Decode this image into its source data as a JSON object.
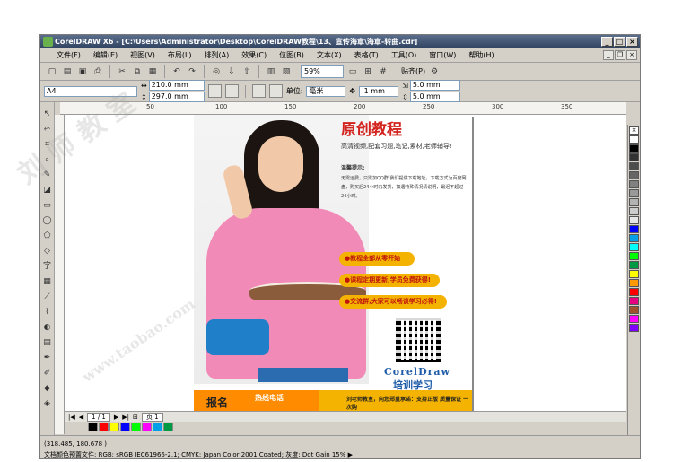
{
  "window": {
    "title": "CorelDRAW X6 - [C:\\Users\\Administrator\\Desktop\\CorelDRAW教程\\13、宣传海章\\海章-转曲.cdr]"
  },
  "menu": [
    "文件(F)",
    "编辑(E)",
    "视图(V)",
    "布局(L)",
    "排列(A)",
    "效果(C)",
    "位图(B)",
    "文本(X)",
    "表格(T)",
    "工具(O)",
    "窗口(W)",
    "帮助(H)"
  ],
  "standard_bar": {
    "zoom": "59%",
    "snap": "贴齐(P)"
  },
  "property_bar": {
    "paper": "A4",
    "width": "210.0 mm",
    "height": "297.0 mm",
    "units_label": "单位:",
    "units": "毫米",
    "nudge": ".1 mm",
    "dup_x": "5.0 mm",
    "dup_y": "5.0 mm"
  },
  "ruler": {
    "top": [
      "50",
      "100",
      "150",
      "200",
      "250",
      "300",
      "350"
    ]
  },
  "poster": {
    "title": "原创教程",
    "subtitle": "高清视频,配套习题,笔记,素材,老师辅导!",
    "tip_head": "温馨提示:",
    "tip": "无需运费，只需加QQ群,我们提供下载地址，下载方式为百度网盘，购买后24小时内发货，如遇特殊情况请说明，最迟不超过24小时。",
    "pills": [
      "●教程全部从零开始",
      "●课程定期更新,学员免费获得!",
      "●交流群,大家可以畅谈学习必得!"
    ],
    "brand1": "CorelDraw",
    "brand2": "培训学习",
    "bottom_left": "报名",
    "bottom_hotline": "热线电话",
    "bottom_right": "刘老师教室，向您郑重承诺：支持正版 质量保证 一次购"
  },
  "page_nav": {
    "counter": "1 / 1",
    "tab": "页 1"
  },
  "status": {
    "coords": "(318.485, 180.678 )",
    "profile": "文档颜色预置文件: RGB: sRGB IEC61966-2.1; CMYK: Japan Color 2001 Coated; 灰度: Dot Gain 15% ▶"
  },
  "palette_colors": [
    "#ffffff",
    "#000000",
    "#333333",
    "#4d4d4d",
    "#666666",
    "#808080",
    "#999999",
    "#b3b3b3",
    "#cccccc",
    "#e6e6e6",
    "#0000ff",
    "#00a0e9",
    "#00ffff",
    "#00ff00",
    "#009944",
    "#ffff00",
    "#ff9900",
    "#ff0000",
    "#e4007f",
    "#a0522d",
    "#ff00ff",
    "#8000ff"
  ],
  "bottom_colors": [
    "#000000",
    "#ff0000",
    "#ffff00",
    "#0000ff",
    "#00ff00",
    "#ff00ff",
    "#00a0e9",
    "#009944"
  ],
  "watermark": [
    "刘 师 教 室",
    "www.taobao.com"
  ]
}
